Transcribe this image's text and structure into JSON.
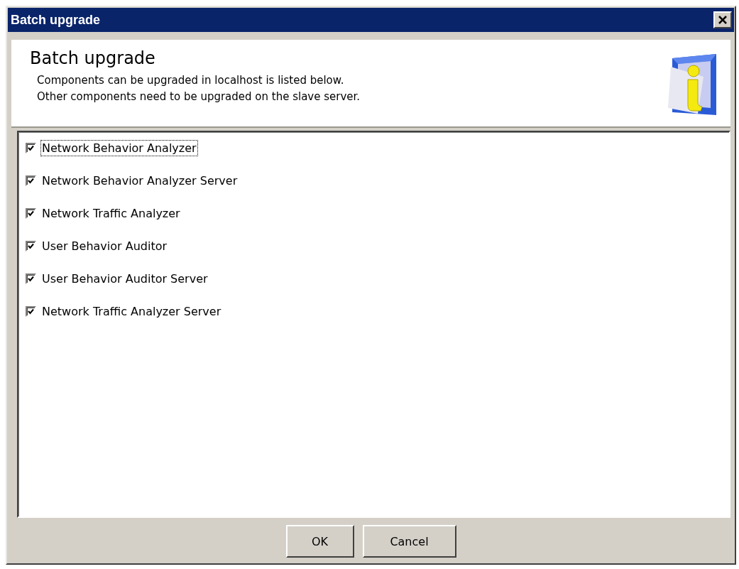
{
  "window": {
    "title": "Batch upgrade"
  },
  "header": {
    "title": "Batch upgrade",
    "lines": [
      "Components can be upgraded in localhost is listed below.",
      "Other components need to be upgraded on the slave server."
    ]
  },
  "components": [
    {
      "label": "Network Behavior Analyzer",
      "checked": true,
      "focused": true
    },
    {
      "label": "Network Behavior Analyzer Server",
      "checked": true,
      "focused": false
    },
    {
      "label": "Network Traffic Analyzer",
      "checked": true,
      "focused": false
    },
    {
      "label": "User Behavior Auditor",
      "checked": true,
      "focused": false
    },
    {
      "label": "User Behavior Auditor Server",
      "checked": true,
      "focused": false
    },
    {
      "label": "Network Traffic Analyzer Server",
      "checked": true,
      "focused": false
    }
  ],
  "buttons": [
    "OK",
    "Cancel"
  ]
}
